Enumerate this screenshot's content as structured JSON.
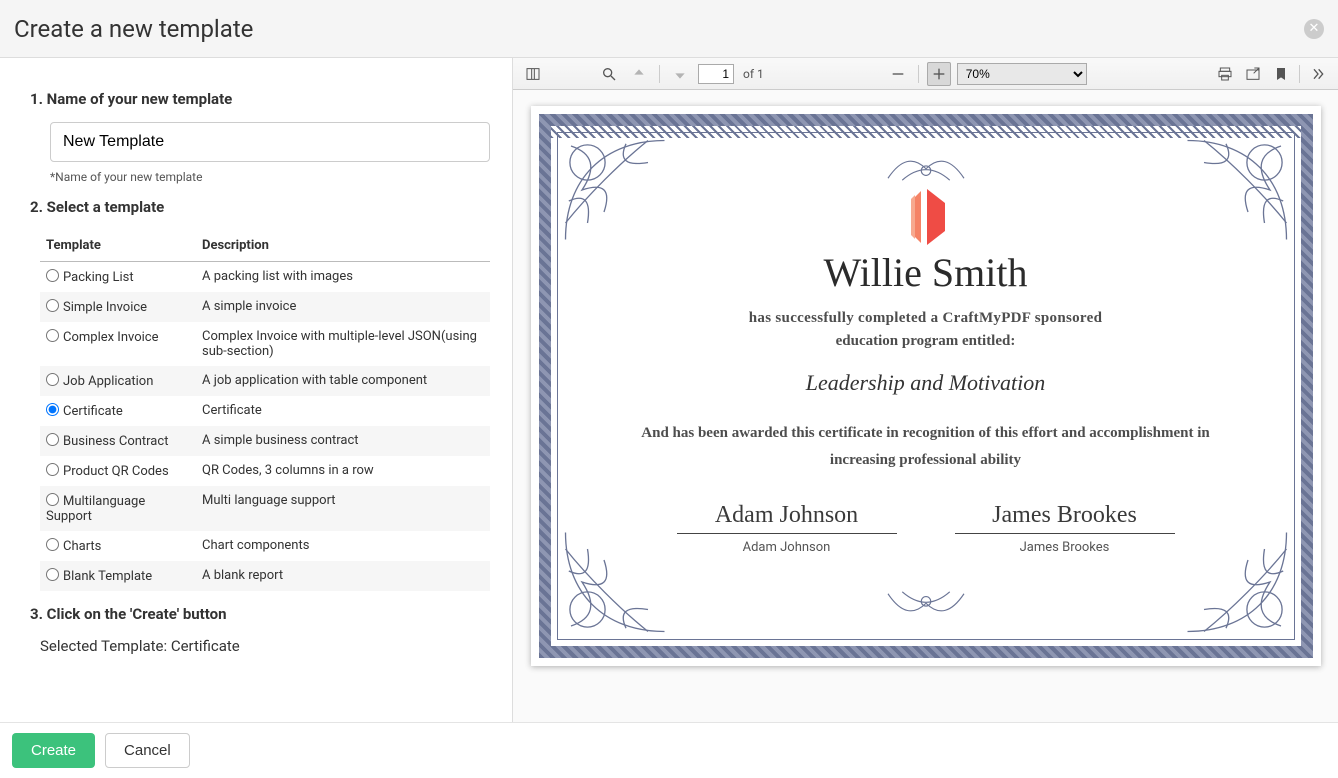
{
  "modal": {
    "title": "Create a new template"
  },
  "step1": {
    "heading": "1. Name of your new template",
    "value": "New Template",
    "helper": "*Name of your new template"
  },
  "step2": {
    "heading": "2. Select a template",
    "col_template": "Template",
    "col_description": "Description",
    "rows": [
      {
        "name": "Packing List",
        "desc": "A packing list with images",
        "selected": false
      },
      {
        "name": "Simple Invoice",
        "desc": "A simple invoice",
        "selected": false
      },
      {
        "name": "Complex Invoice",
        "desc": "Complex Invoice with multiple-level JSON(using sub-section)",
        "selected": false
      },
      {
        "name": "Job Application",
        "desc": "A job application with table component",
        "selected": false
      },
      {
        "name": "Certificate",
        "desc": "Certificate",
        "selected": true
      },
      {
        "name": "Business Contract",
        "desc": "A simple business contract",
        "selected": false
      },
      {
        "name": "Product QR Codes",
        "desc": "QR Codes, 3 columns in a row",
        "selected": false
      },
      {
        "name": "Multilanguage Support",
        "desc": "Multi language support",
        "selected": false
      },
      {
        "name": "Charts",
        "desc": "Chart components",
        "selected": false
      },
      {
        "name": "Blank Template",
        "desc": "A blank report",
        "selected": false
      }
    ]
  },
  "step3": {
    "heading": "3. Click on the 'Create' button",
    "selected_label": "Selected Template: ",
    "selected_value": "Certificate"
  },
  "viewer": {
    "page_input": "1",
    "page_of": "of 1",
    "zoom": "70%"
  },
  "certificate": {
    "recipient": "Willie Smith",
    "line1": "has successfully completed a CraftMyPDF sponsored",
    "line2": "education program entitled:",
    "course": "Leadership and Motivation",
    "award": "And has been awarded this certificate in recognition of this effort and accomplishment in increasing professional ability",
    "sig1_script": "Adam Johnson",
    "sig1_name": "Adam Johnson",
    "sig2_script": "James Brookes",
    "sig2_name": "James Brookes"
  },
  "footer": {
    "create": "Create",
    "cancel": "Cancel"
  }
}
